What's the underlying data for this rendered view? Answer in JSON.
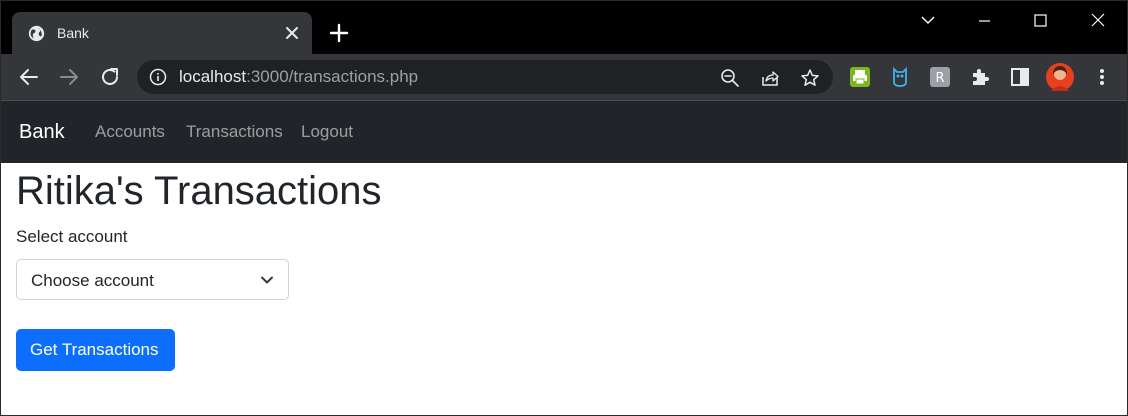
{
  "browser": {
    "tab": {
      "title": "Bank",
      "favicon": "globe-icon"
    },
    "url": {
      "host": "localhost",
      "rest": ":3000/transactions.php"
    },
    "extensions": [
      "print-extension-icon",
      "owl-extension-icon",
      "r-extension-icon",
      "puzzle-extensions-icon"
    ],
    "colors": {
      "titlebar": "#000000",
      "toolbar": "#35363a",
      "omnibox": "#202124"
    }
  },
  "navbar": {
    "brand": "Bank",
    "links": [
      "Accounts",
      "Transactions",
      "Logout"
    ],
    "background": "#212529"
  },
  "main": {
    "heading": "Ritika's Transactions",
    "select_label": "Select account",
    "select_value": "Choose account",
    "button_label": "Get Transactions",
    "button_color": "#0d6efd"
  }
}
